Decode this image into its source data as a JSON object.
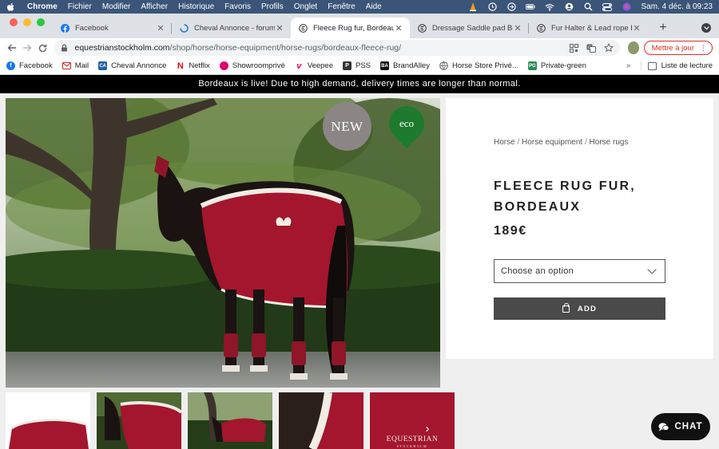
{
  "menubar": {
    "app": "Chrome",
    "items": [
      "Fichier",
      "Modifier",
      "Afficher",
      "Historique",
      "Favoris",
      "Profils",
      "Onglet",
      "Fenêtre",
      "Aide"
    ],
    "clock": "Sam. 4 déc. à  09:23"
  },
  "tabs": [
    {
      "title": "Facebook",
      "icon": "facebook-icon"
    },
    {
      "title": "Cheval Annonce - forum ch",
      "icon": "loading-icon"
    },
    {
      "title": "Fleece Rug fur, Bordeaux",
      "icon": "equestrian-icon"
    },
    {
      "title": "Dressage Saddle pad Bordea",
      "icon": "equestrian-icon"
    },
    {
      "title": "Fur Halter & Lead rope Bord",
      "icon": "equestrian-icon"
    }
  ],
  "toolbar": {
    "url_host": "equestrianstockholm.com",
    "url_path": "/shop/horse/horse-equipment/horse-rugs/bordeaux-fleece-rug/",
    "update_label": "Mettre à jour"
  },
  "bookmarks": {
    "items": [
      {
        "label": "Facebook",
        "icon": "facebook-icon",
        "color": "#1877f2",
        "glyph": "f"
      },
      {
        "label": "Mail",
        "icon": "mail-icon",
        "color": "#ffffff",
        "glyph": ""
      },
      {
        "label": "Cheval Annonce",
        "icon": "cheval-annonce-icon",
        "color": "#1f5fa8",
        "glyph": "CA"
      },
      {
        "label": "Netflix",
        "icon": "netflix-icon",
        "color": "#ffffff",
        "glyph": "N"
      },
      {
        "label": "Showroomprivé",
        "icon": "showroomprive-icon",
        "color": "#e0006d",
        "glyph": ""
      },
      {
        "label": "Veepee",
        "icon": "veepee-icon",
        "color": "#ffffff",
        "glyph": "v"
      },
      {
        "label": "PSS",
        "icon": "pss-icon",
        "color": "#333333",
        "glyph": "P"
      },
      {
        "label": "BrandAlley",
        "icon": "brandalley-icon",
        "color": "#111111",
        "glyph": "BA"
      },
      {
        "label": "Horse Store Privé...",
        "icon": "globe-icon",
        "color": "#ffffff",
        "glyph": ""
      },
      {
        "label": "Private-green",
        "icon": "private-green-icon",
        "color": "#2e8b57",
        "glyph": "PG"
      }
    ],
    "more": "»",
    "reading_list": "Liste de lecture"
  },
  "page": {
    "announcement": "Bordeaux is live! Due to high demand, delivery times are longer than normal.",
    "badge_new": "NEW",
    "badge_eco": "eco",
    "breadcrumb": [
      "Horse",
      "Horse equipment",
      "Horse rugs"
    ],
    "title": "FLEECE RUG FUR, BORDEAUX",
    "price": "189€",
    "select_placeholder": "Choose an option",
    "add_label": "ADD",
    "chat_label": "CHAT"
  },
  "colors": {
    "accent_bordeaux": "#a3162e",
    "update_red": "#d93025",
    "add_button": "#4a4a4a",
    "eco_green": "#1e7a2e"
  }
}
